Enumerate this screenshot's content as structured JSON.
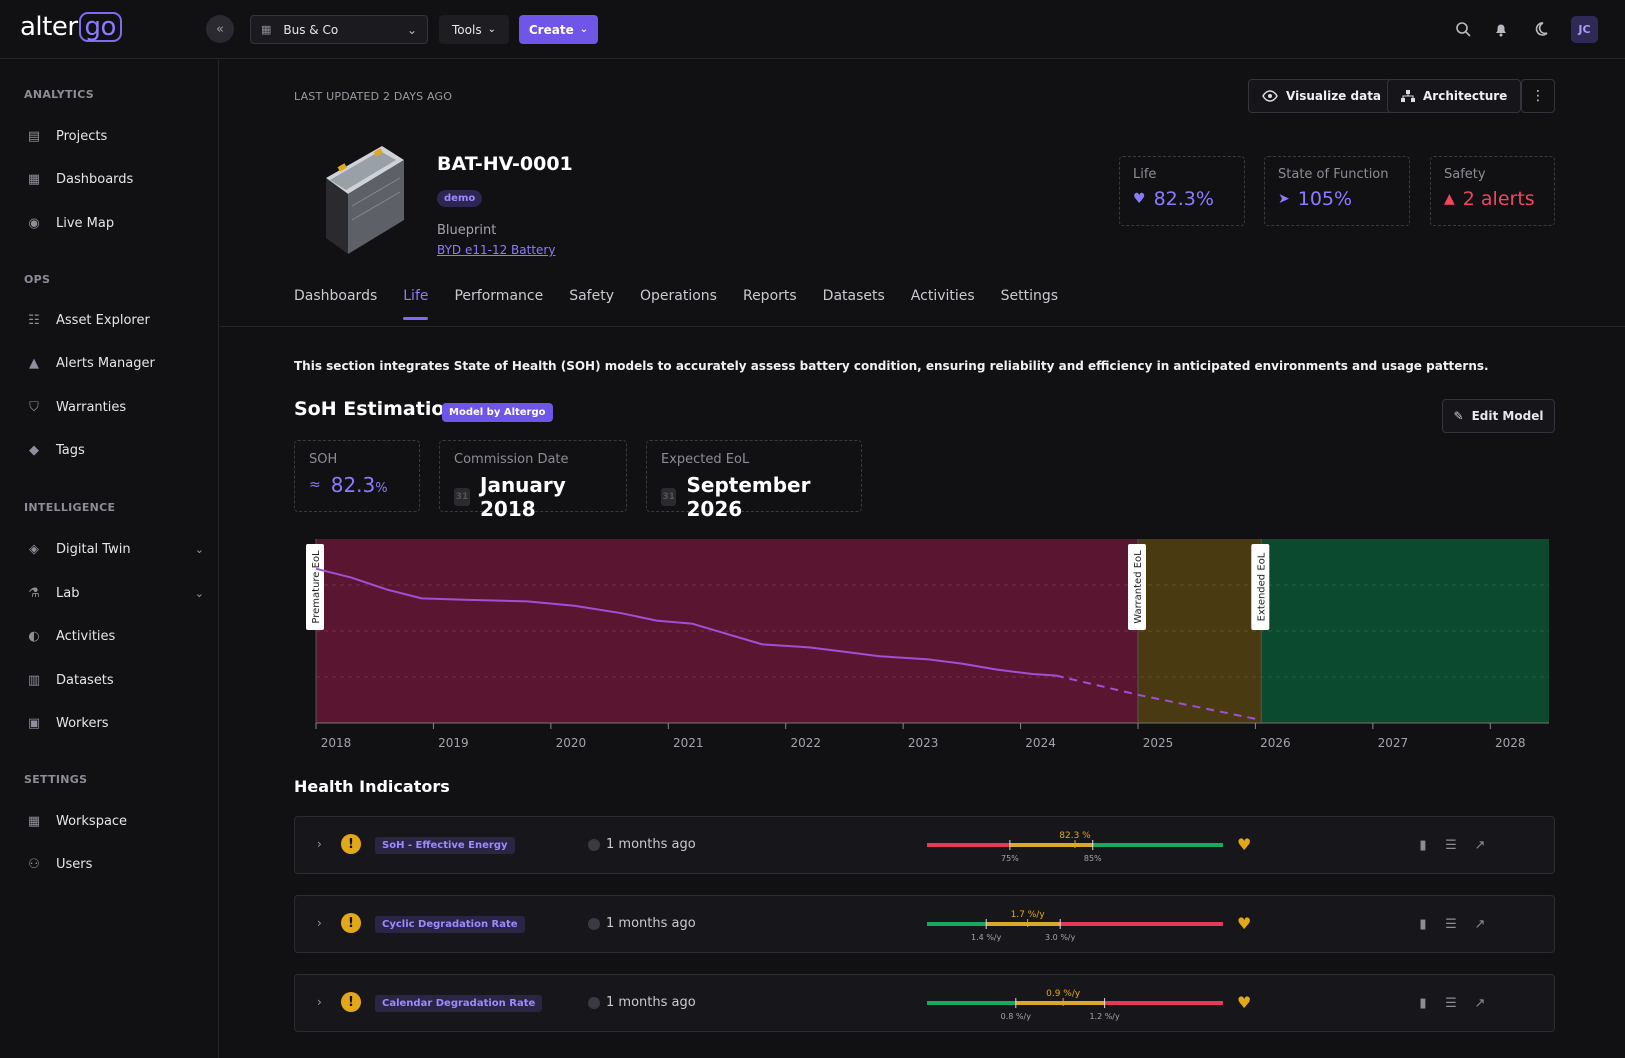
{
  "app": {
    "logo_prefix": "alter",
    "logo_suffix": "go"
  },
  "topbar": {
    "workspace": "Bus & Co",
    "tools_label": "Tools",
    "create_label": "Create",
    "avatar_initials": "JC"
  },
  "sidebar": {
    "sections": [
      {
        "title": "ANALYTICS",
        "items": [
          {
            "label": "Projects",
            "icon": "projects-icon"
          },
          {
            "label": "Dashboards",
            "icon": "dashboards-icon"
          },
          {
            "label": "Live Map",
            "icon": "map-icon"
          }
        ]
      },
      {
        "title": "OPS",
        "items": [
          {
            "label": "Asset Explorer",
            "icon": "asset-explorer-icon"
          },
          {
            "label": "Alerts Manager",
            "icon": "bell-icon"
          },
          {
            "label": "Warranties",
            "icon": "shield-icon"
          },
          {
            "label": "Tags",
            "icon": "tag-icon"
          }
        ]
      },
      {
        "title": "INTELLIGENCE",
        "items": [
          {
            "label": "Digital Twin",
            "icon": "cube-icon"
          },
          {
            "label": "Lab",
            "icon": "flask-icon"
          },
          {
            "label": "Activities",
            "icon": "activity-icon"
          },
          {
            "label": "Datasets",
            "icon": "file-icon"
          },
          {
            "label": "Workers",
            "icon": "workers-icon"
          }
        ]
      },
      {
        "title": "SETTINGS",
        "items": [
          {
            "label": "Workspace",
            "icon": "building-icon"
          },
          {
            "label": "Users",
            "icon": "users-icon"
          }
        ]
      }
    ]
  },
  "header": {
    "last_updated": "LAST UPDATED 2 DAYS AGO",
    "visualize_label": "Visualize data",
    "architecture_label": "Architecture"
  },
  "asset": {
    "title": "BAT-HV-0001",
    "tag": "demo",
    "blueprint_label": "Blueprint",
    "blueprint_link": "BYD e11-12 Battery"
  },
  "kpis": [
    {
      "label": "Life",
      "value": "82.3%",
      "color": "#8b7cff"
    },
    {
      "label": "State of Function",
      "value": "105%",
      "color": "#8b7cff"
    },
    {
      "label": "Safety",
      "value": "2 alerts",
      "color": "#f0465f"
    }
  ],
  "tabs": [
    "Dashboards",
    "Life",
    "Performance",
    "Safety",
    "Operations",
    "Reports",
    "Datasets",
    "Activities",
    "Settings"
  ],
  "active_tab": "Life",
  "description": "This section integrates State of Health (SOH) models to accurately assess battery condition, ensuring reliability and efficiency in anticipated environments and usage patterns.",
  "soh": {
    "title": "SoH Estimation",
    "badge": "Model by Altergo",
    "edit_label": "Edit Model",
    "stats": [
      {
        "label": "SOH",
        "value": "82.3",
        "unit": "%"
      },
      {
        "label": "Commission Date",
        "value": "January 2018"
      },
      {
        "label": "Expected EoL",
        "value": "September 2026"
      }
    ]
  },
  "chart_data": {
    "type": "line",
    "x_range": [
      2018,
      2028.5
    ],
    "x_ticks": [
      "2018",
      "2019",
      "2020",
      "2021",
      "2022",
      "2023",
      "2024",
      "2025",
      "2026",
      "2027",
      "2028"
    ],
    "zones": [
      {
        "label": "Premature EoL",
        "from": 2018,
        "to": 2025,
        "color": "#5a1630"
      },
      {
        "label": "Warranted EoL",
        "from": 2025,
        "to": 2026.05,
        "color": "#4a3a12"
      },
      {
        "label": "Extended EoL",
        "from": 2026.05,
        "to": 2028.5,
        "color": "#0b4a2e"
      }
    ],
    "series": [
      {
        "style": "solid",
        "color": "#a14fd6",
        "x": [
          2018.0,
          2018.3,
          2018.6,
          2018.9,
          2019.3,
          2019.8,
          2020.2,
          2020.6,
          2020.9,
          2021.2,
          2021.5,
          2021.8,
          2022.2,
          2022.5,
          2022.8,
          2023.2,
          2023.5,
          2023.8,
          2024.1,
          2024.3
        ],
        "y": [
          1.0,
          0.97,
          0.93,
          0.9,
          0.895,
          0.89,
          0.875,
          0.85,
          0.825,
          0.815,
          0.78,
          0.745,
          0.735,
          0.72,
          0.705,
          0.695,
          0.68,
          0.66,
          0.645,
          0.64
        ]
      },
      {
        "style": "dashed",
        "color": "#a14fd6",
        "x": [
          2024.3,
          2025.0,
          2026.05
        ],
        "y": [
          0.64,
          0.575,
          0.49
        ]
      }
    ],
    "ylim": [
      0.48,
      1.1
    ]
  },
  "health_indicators": {
    "title": "Health Indicators",
    "rows": [
      {
        "name": "SoH - Effective Energy",
        "time": "1 months ago",
        "value_label": "82.3 %",
        "marks": [
          "75%",
          "85%"
        ],
        "segments": [
          "#e5395a",
          "#d9a92b",
          "#18a860"
        ],
        "bounds": [
          0,
          0.28,
          0.56,
          1
        ],
        "value_pos": 0.5
      },
      {
        "name": "Cyclic Degradation Rate",
        "time": "1 months ago",
        "value_label": "1.7 %/y",
        "marks": [
          "1.4 %/y",
          "3.0 %/y"
        ],
        "segments": [
          "#18a860",
          "#d9a92b",
          "#e5395a"
        ],
        "bounds": [
          0,
          0.2,
          0.45,
          1
        ],
        "value_pos": 0.34
      },
      {
        "name": "Calendar Degradation Rate",
        "time": "1 months ago",
        "value_label": "0.9 %/y",
        "marks": [
          "0.8 %/y",
          "1.2 %/y"
        ],
        "segments": [
          "#18a860",
          "#d9a92b",
          "#e5395a"
        ],
        "bounds": [
          0,
          0.3,
          0.6,
          1
        ],
        "value_pos": 0.46
      }
    ]
  }
}
